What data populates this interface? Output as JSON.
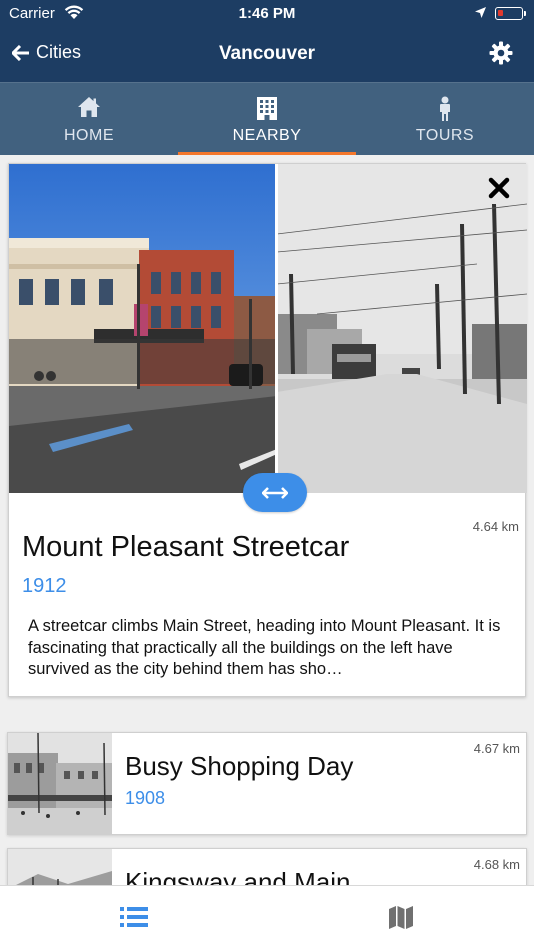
{
  "status_bar": {
    "carrier": "Carrier",
    "time": "1:46 PM"
  },
  "nav": {
    "back_label": "Cities",
    "title": "Vancouver"
  },
  "tabs": [
    {
      "label": "HOME",
      "icon": "home-icon"
    },
    {
      "label": "NEARBY",
      "icon": "building-icon",
      "active": true
    },
    {
      "label": "TOURS",
      "icon": "person-icon"
    }
  ],
  "featured": {
    "distance": "4.64 km",
    "title": "Mount Pleasant Streetcar",
    "year": "1912",
    "description": "A streetcar climbs Main Street, heading into Mount Pleasant. It is fascinating that practically all the buildings on the left have survived as the city behind them has sho…"
  },
  "list": [
    {
      "distance": "4.67 km",
      "title": "Busy Shopping Day",
      "year": "1908"
    },
    {
      "distance": "4.68 km",
      "title": "Kingsway and Main",
      "year": ""
    }
  ],
  "bottom_bar": {
    "list_icon": "list-icon",
    "map_icon": "map-icon"
  },
  "colors": {
    "nav_bg": "#1d3d63",
    "tab_bg": "#41617f",
    "accent_orange": "#f4772b",
    "link_blue": "#3d8ee8"
  }
}
